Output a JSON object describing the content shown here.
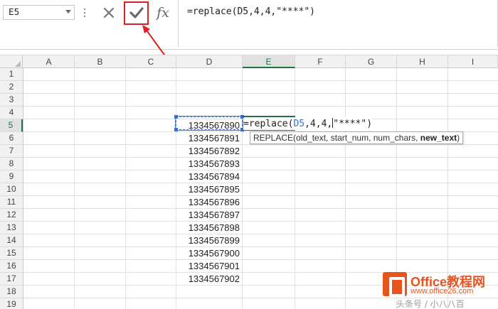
{
  "namebox": {
    "value": "E5"
  },
  "formula_bar": {
    "formula": "=replace(D5,4,4,\"****\")"
  },
  "columns": [
    "A",
    "B",
    "C",
    "D",
    "E",
    "F",
    "G",
    "H",
    "I"
  ],
  "rows": [
    "1",
    "2",
    "3",
    "4",
    "5",
    "6",
    "7",
    "8",
    "9",
    "10",
    "11",
    "12",
    "13",
    "14",
    "15",
    "16",
    "17",
    "18",
    "19"
  ],
  "active_cell": {
    "column": "E",
    "row": "5"
  },
  "column_d_values": [
    "1334567890",
    "1334567891",
    "1334567892",
    "1334567893",
    "1334567894",
    "1334567895",
    "1334567896",
    "1334567897",
    "1334567898",
    "1334567899",
    "1334567900",
    "1334567901",
    "1334567902"
  ],
  "cell_edit": {
    "prefix": "=replace(",
    "ref": "D5",
    "args": ",4,4,",
    "tail": "\"****\")"
  },
  "tooltip": {
    "func": "REPLACE(",
    "params": "old_text, start_num, num_chars, ",
    "current_param": "new_text",
    "close": ")"
  },
  "icons": {
    "cancel": "close-icon",
    "enter": "checkmark-icon",
    "function": "fx-icon"
  },
  "watermark": {
    "title": "Office教程网",
    "site": "www.office26.com",
    "subtitle": "头条号 / 小八八百"
  },
  "colors": {
    "accent": "#217346",
    "reference": "#3a6fd6",
    "highlight": "#e02020",
    "brand": "#e8541e"
  }
}
